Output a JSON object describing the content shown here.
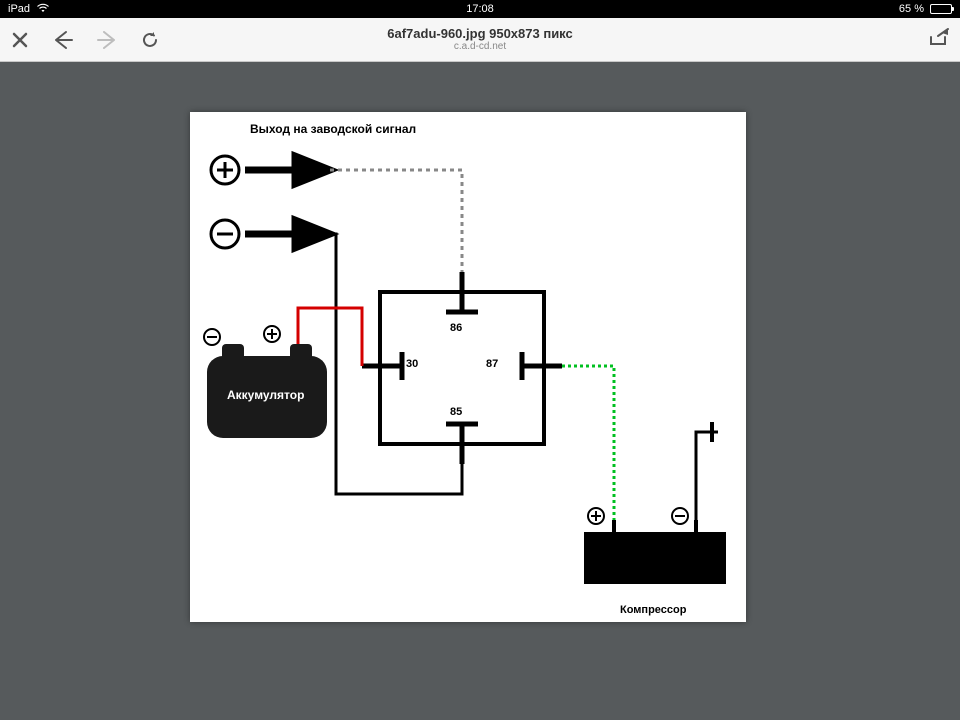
{
  "status": {
    "carrier": "iPad",
    "time": "17:08",
    "battery_text": "65 %"
  },
  "toolbar": {
    "title": "6af7adu-960.jpg 950x873 пикс",
    "subtitle": "c.a.d-cd.net"
  },
  "diagram": {
    "title": "Выход на заводской сигнал",
    "battery_label": "Аккумулятор",
    "compressor_label": "Компрессор",
    "relay_pins": {
      "p30": "30",
      "p85": "85",
      "p86": "86",
      "p87": "87"
    },
    "plus_glyph": "+",
    "minus_glyph": "−"
  }
}
